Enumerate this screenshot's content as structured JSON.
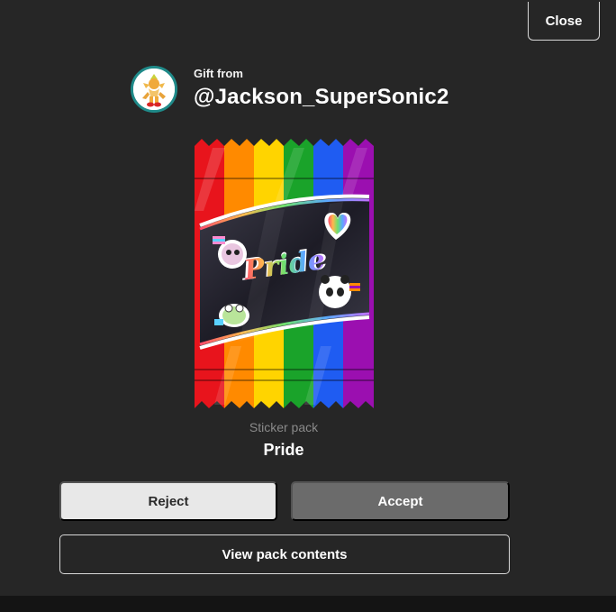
{
  "dialog": {
    "close_label": "Close",
    "gift_from_label": "Gift from",
    "sender_username": "@Jackson_SuperSonic2"
  },
  "pack": {
    "type_label": "Sticker pack",
    "name": "Pride",
    "artwork_text": "Pride",
    "artwork_stickers": [
      "skull-with-flag-sticker",
      "rainbow-heart-sticker",
      "frog-with-flag-sticker",
      "panda-with-flag-sticker"
    ]
  },
  "actions": {
    "reject_label": "Reject",
    "accept_label": "Accept",
    "view_contents_label": "View pack contents"
  },
  "colors": {
    "modal_bg": "#262626",
    "accept_bg": "#6b6b6b",
    "reject_bg": "#e8e8e8",
    "avatar_ring": "#1f8a89",
    "rainbow": [
      "#e8141c",
      "#ff8a00",
      "#ffd400",
      "#1aa32a",
      "#1f5cf2",
      "#9b0fb0"
    ]
  }
}
